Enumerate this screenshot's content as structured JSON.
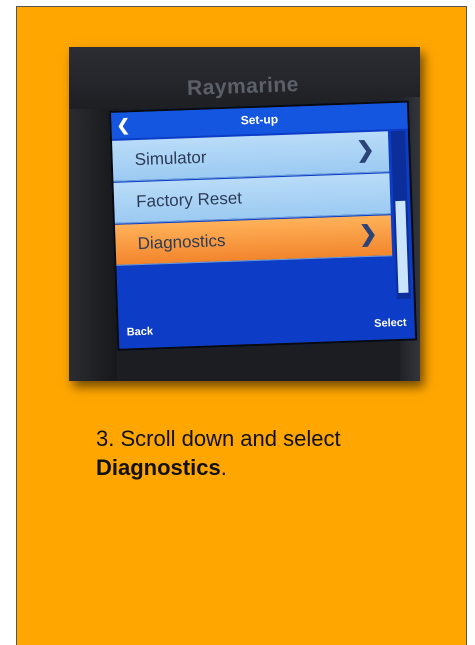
{
  "photo": {
    "brand": "Raymarine",
    "screen": {
      "title": "Set-up",
      "back_icon": "chevron-left-icon",
      "items": [
        {
          "label": "Simulator",
          "has_chevron": true,
          "selected": false
        },
        {
          "label": "Factory Reset",
          "has_chevron": false,
          "selected": false
        },
        {
          "label": "Diagnostics",
          "has_chevron": true,
          "selected": true
        }
      ],
      "softkeys": {
        "left": "Back",
        "right": "Select"
      },
      "colors": {
        "header": "#1556e0",
        "item": "#9ccaf2",
        "selected": "#f2852c"
      }
    }
  },
  "caption": {
    "prefix": "3. Scroll down and select ",
    "bold": "Diagnostics",
    "suffix": "."
  },
  "colors": {
    "card_background": "#ffa600"
  }
}
